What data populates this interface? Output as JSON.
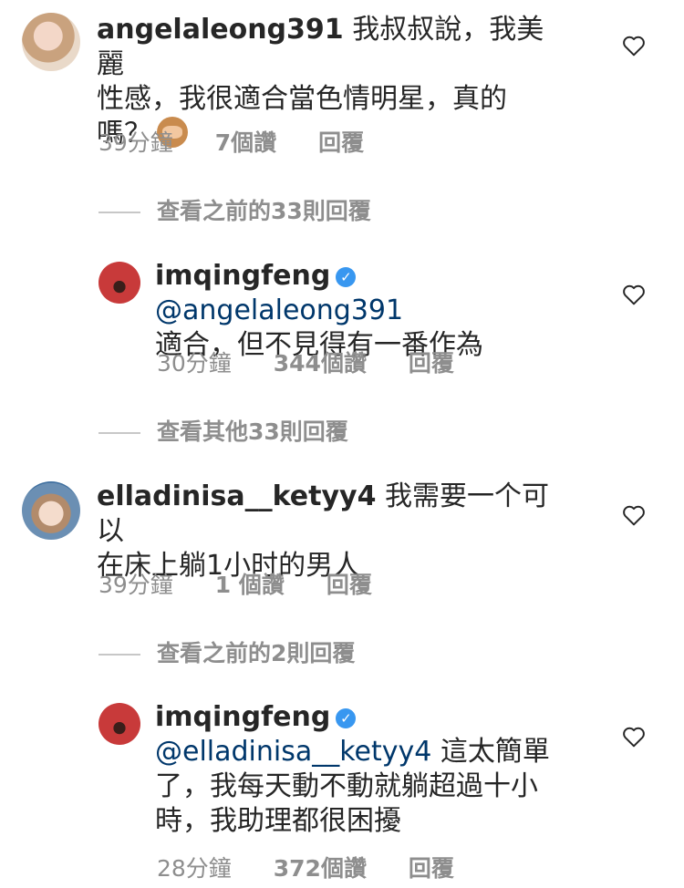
{
  "comments": [
    {
      "username": "angelaleong391",
      "text": "我叔叔說，我美麗性感，我很適合當色情明星，真的嗎？",
      "line1": "我叔叔說，我美麗",
      "line2": "性感，我很適合當色情明星，真的",
      "line3": "嗎？",
      "time": "39分鐘",
      "likes": "7個讚",
      "reply": "回覆",
      "emoji": "see-no-evil-monkey"
    },
    {
      "view_replies": "查看之前的33則回覆"
    },
    {
      "username": "imqingfeng",
      "verified": true,
      "mention": "@angelaleong391",
      "line2": "適合，但不見得有一番作為",
      "time": "30分鐘",
      "likes": "344個讚",
      "reply": "回覆"
    },
    {
      "view_replies": "查看其他33則回覆"
    },
    {
      "username": "elladinisa__ketyy4",
      "line1": "我需要一个可以",
      "line2": "在床上躺1小时的男人",
      "time": "39分鐘",
      "likes": "1 個讚",
      "reply": "回覆"
    },
    {
      "view_replies": "查看之前的2則回覆"
    },
    {
      "username": "imqingfeng",
      "verified": true,
      "mention": "@elladinisa__ketyy4",
      "line1": "這太簡單",
      "line2": "了，我每天動不動就躺超過十小",
      "line3": "時，我助理都很困擾",
      "time": "28分鐘",
      "likes": "372個讚",
      "reply": "回覆"
    }
  ],
  "colors": {
    "text": "#262626",
    "muted": "#8e8e8e",
    "mention": "#00376b",
    "verified": "#3897f0"
  }
}
